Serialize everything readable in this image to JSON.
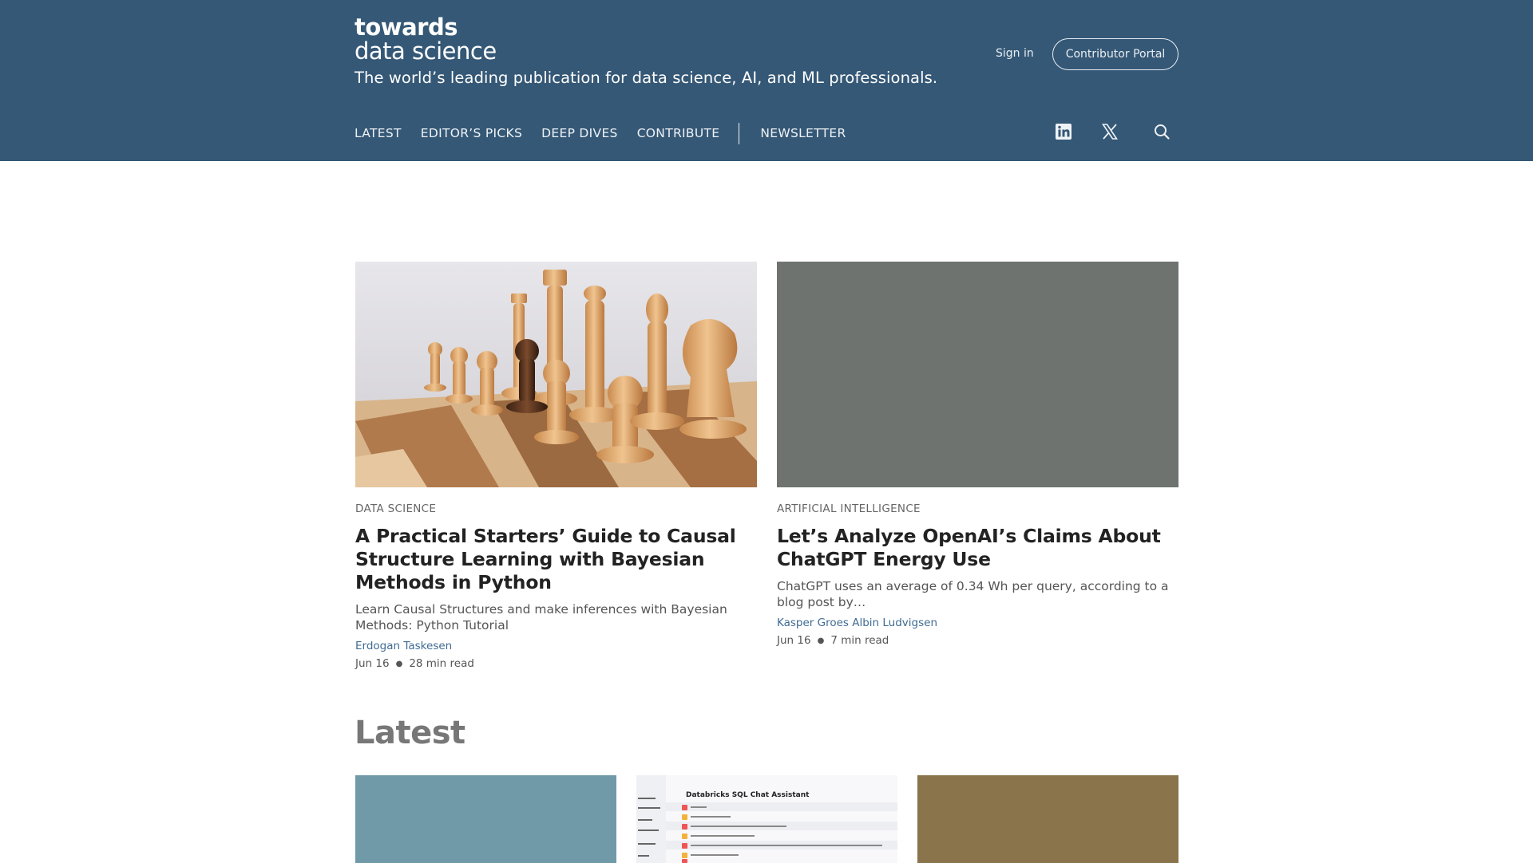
{
  "header": {
    "logo_line1": "towards",
    "logo_line2": "data science",
    "tagline": "The world’s leading publication for data science, AI, and ML professionals.",
    "sign_in": "Sign in",
    "portal_button": "Contributor Portal",
    "nav": [
      "LATEST",
      "EDITOR’S PICKS",
      "DEEP DIVES",
      "CONTRIBUTE"
    ],
    "newsletter": "NEWSLETTER",
    "icons": [
      "linkedin-icon",
      "x-icon",
      "search-icon"
    ]
  },
  "featured": [
    {
      "category": "DATA SCIENCE",
      "title": "A Practical Starters’ Guide to Causal Structure Learning with Bayesian Methods in Python",
      "description": "Learn Causal Structures and make inferences with Bayesian Methods: Python Tutorial",
      "author": "Erdogan Taskesen",
      "date": "Jun 16",
      "read_time": "28 min read"
    },
    {
      "category": "ARTIFICIAL INTELLIGENCE",
      "title": "Let’s Analyze OpenAI’s Claims About ChatGPT Energy Use",
      "description": "ChatGPT uses an average of 0.34 Wh per query, according to a blog post by…",
      "author": "Kasper Groes Albin Ludvigsen",
      "date": "Jun 16",
      "read_time": "7 min read"
    }
  ],
  "latest": {
    "heading": "Latest",
    "thumb2_title": "Databricks SQL Chat Assistant"
  },
  "colors": {
    "header_bg": "#355876",
    "card2_placeholder": "#6e736f",
    "latest1_placeholder": "#719aa8",
    "latest3_placeholder": "#8a744b"
  }
}
